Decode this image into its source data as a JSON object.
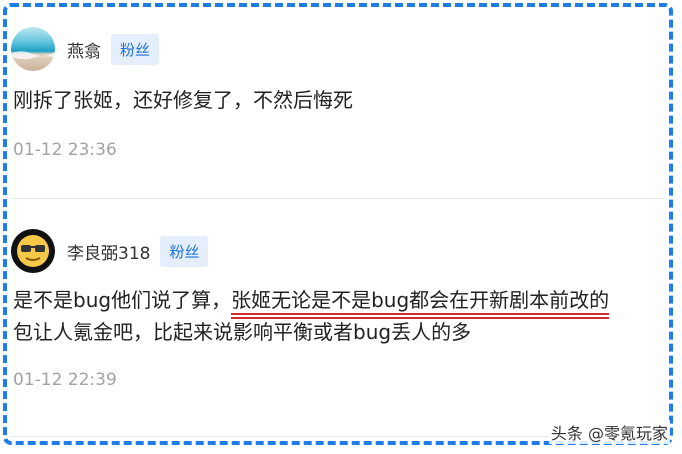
{
  "comments": [
    {
      "username": "燕翕",
      "badge": "粉丝",
      "avatar_icon": "beach-avatar",
      "text": "刚拆了张姬，还好修复了，不然后悔死",
      "timestamp": "01-12 23:36"
    },
    {
      "username": "李良弼318",
      "badge": "粉丝",
      "avatar_icon": "sunglasses-emoji-avatar",
      "text_before": "是不是bug他们说了算，",
      "text_highlight": "张姬无论是不是bug都会在开新剧本前改的",
      "text_after": "包让人氪金吧，比起来说影响平衡或者bug丢人的多",
      "timestamp": "01-12 22:39"
    }
  ],
  "watermark": "头条 @零氪玩家",
  "colors": {
    "frame_border": "#1f7de8",
    "badge_bg": "#e4eefc",
    "badge_text": "#1d73d8",
    "highlight_underline": "#d32a2a",
    "timestamp": "#a2a2a2"
  }
}
